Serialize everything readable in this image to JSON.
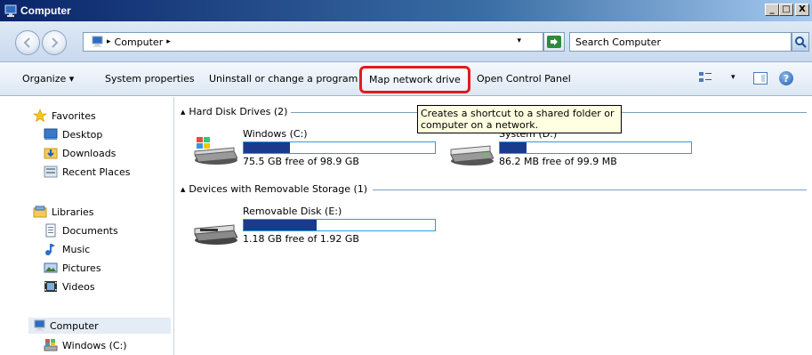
{
  "window": {
    "title": "Computer",
    "minimize_glyph": "_",
    "maximize_glyph": "□",
    "close_glyph": "X"
  },
  "address": {
    "crumb": "Computer",
    "separator": "▸",
    "dropdown": "▾",
    "search_placeholder": "Search Computer"
  },
  "toolbar": {
    "organize": "Organize  ▾",
    "system_properties": "System properties",
    "uninstall": "Uninstall or change a program",
    "map_network_drive": "Map network drive",
    "open_control_panel": "Open Control Panel",
    "help": "?"
  },
  "tooltip": {
    "text": "Creates a shortcut to a shared folder or computer on a network."
  },
  "nav": {
    "favorites": "Favorites",
    "desktop": "Desktop",
    "downloads": "Downloads",
    "recent_places": "Recent Places",
    "libraries": "Libraries",
    "documents": "Documents",
    "music": "Music",
    "pictures": "Pictures",
    "videos": "Videos",
    "computer": "Computer",
    "windows_c": "Windows (C:)"
  },
  "groups": {
    "hard_disk": "Hard Disk Drives (2)",
    "removable": "Devices with Removable Storage (1)"
  },
  "drives": [
    {
      "name": "Windows (C:)",
      "free": "75.5 GB free of 98.9 GB",
      "used_fraction": 0.24
    },
    {
      "name": "System (D:)",
      "free": "86.2 MB free of 99.9 MB",
      "used_fraction": 0.14
    },
    {
      "name": "Removable Disk (E:)",
      "free": "1.18 GB free of 1.92 GB",
      "used_fraction": 0.38
    }
  ],
  "colors": {
    "title_gradient_start": "#0a246a",
    "highlight_border": "#e31b1b",
    "bar_fill": "#1a3a8e",
    "tooltip_bg": "#ffffe1"
  }
}
